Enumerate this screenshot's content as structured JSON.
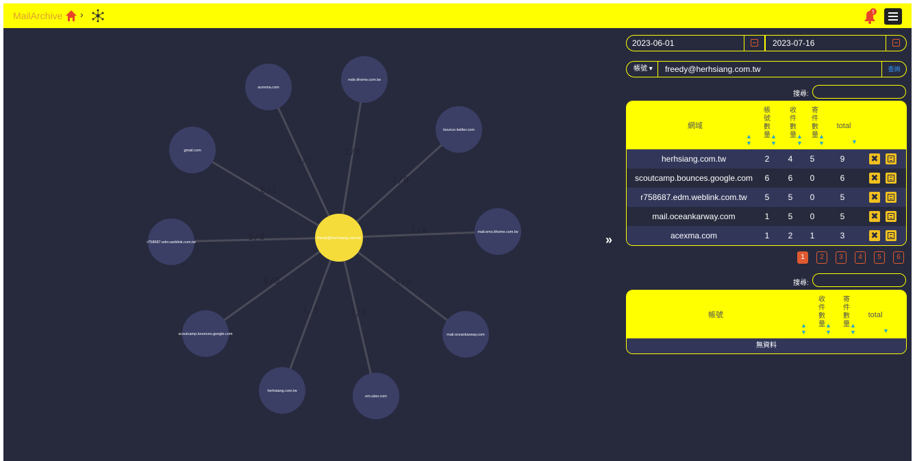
{
  "header": {
    "brand": "MailArchive",
    "crumb_sep": "›",
    "home_icon": "home-icon",
    "graph_icon": "network-graph-icon",
    "bell_icon": "notification-bell-icon",
    "menu_icon": "hamburger-menu-icon",
    "bell_badge": "!",
    "accent": "#ffff00"
  },
  "graph": {
    "center": "freedy@herhsiang.com.tw",
    "nodes": [
      {
        "label": "acexma.com",
        "edge": "2/1"
      },
      {
        "label": "mde.ithome.com.tw",
        "edge": "2/0"
      },
      {
        "label": "bounce.twitter.com",
        "edge": "3/0"
      },
      {
        "label": "gmail.com",
        "edge": "0/1"
      },
      {
        "label": "mail.ems.ithome.com.tw",
        "edge": "2/0"
      },
      {
        "label": "r758687.edm.weblink.com.tw",
        "edge": "5/0"
      },
      {
        "label": "mail.oceankarway.com",
        "edge": "5/0"
      },
      {
        "label": "scoutcamp.bounces.google.com",
        "edge": "6/0"
      },
      {
        "label": "herhsiang.com.tw",
        "edge": "4/5"
      },
      {
        "label": "em.uber.com",
        "edge": "2/0"
      }
    ]
  },
  "toggle": "»",
  "filters": {
    "date_start": "2023-06-01",
    "date_end": "2023-07-16",
    "account_type": "帳號 ▾",
    "account_value": "freedy@herhsiang.com.tw",
    "query_button": "查詢"
  },
  "domain_table": {
    "search_label": "搜尋:",
    "headers": {
      "domain": "網域",
      "accounts": [
        "帳",
        "號",
        "數",
        "量"
      ],
      "received": [
        "收",
        "件",
        "數",
        "量"
      ],
      "sent": [
        "寄",
        "件",
        "數",
        "量"
      ],
      "total": "total"
    },
    "rows": [
      {
        "domain": "herhsiang.com.tw",
        "accounts": "2",
        "received": "4",
        "sent": "5",
        "total": "9"
      },
      {
        "domain": "scoutcamp.bounces.google.com",
        "accounts": "6",
        "received": "6",
        "sent": "0",
        "total": "6"
      },
      {
        "domain": "r758687.edm.weblink.com.tw",
        "accounts": "5",
        "received": "5",
        "sent": "0",
        "total": "5"
      },
      {
        "domain": "mail.oceankarway.com",
        "accounts": "1",
        "received": "5",
        "sent": "0",
        "total": "5"
      },
      {
        "domain": "acexma.com",
        "accounts": "1",
        "received": "2",
        "sent": "1",
        "total": "3"
      }
    ],
    "pages": [
      "1",
      "2",
      "3",
      "4",
      "5",
      "6"
    ],
    "active_page": "1"
  },
  "account_table": {
    "search_label": "搜尋:",
    "headers": {
      "account": "帳號",
      "received": [
        "收",
        "件",
        "數",
        "量"
      ],
      "sent": [
        "寄",
        "件",
        "數",
        "量"
      ],
      "total": "total"
    },
    "empty": "無資料"
  }
}
